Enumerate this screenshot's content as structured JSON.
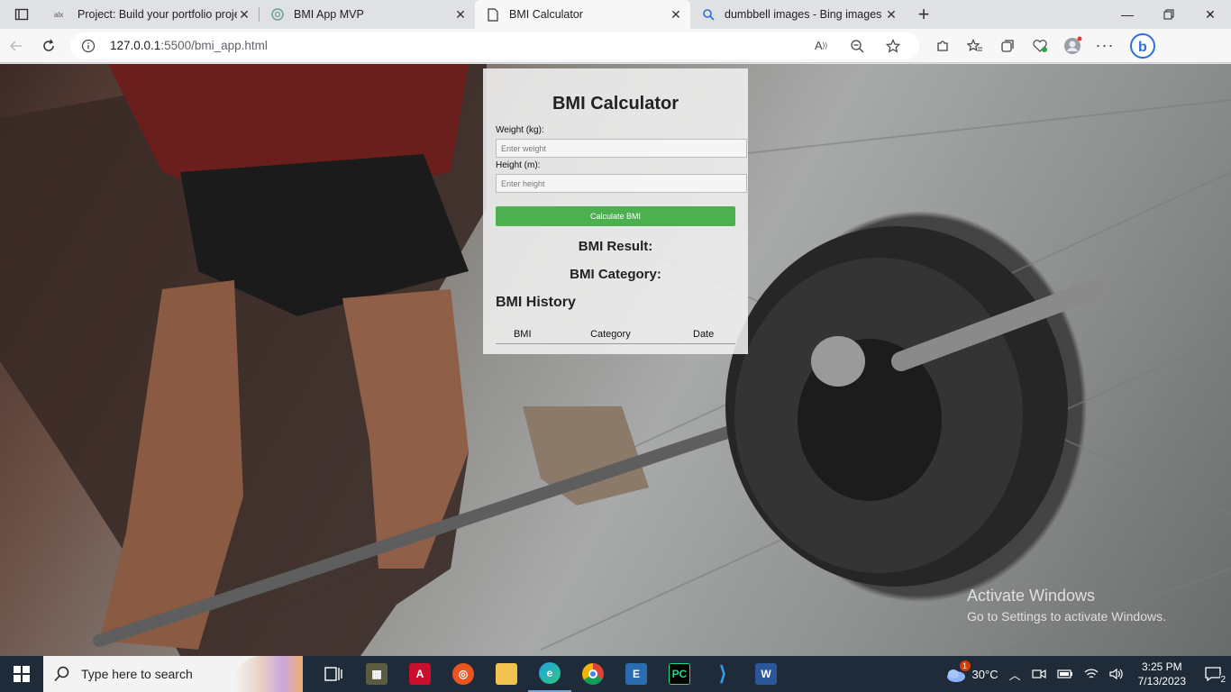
{
  "browser": {
    "tabs": [
      {
        "title": "Project: Build your portfolio proje",
        "icon": "alx-icon",
        "active": false
      },
      {
        "title": "BMI App MVP",
        "icon": "chatgpt-icon",
        "active": false
      },
      {
        "title": "BMI Calculator",
        "icon": "page-icon",
        "active": true
      },
      {
        "title": "dumbbell images - Bing images",
        "icon": "search-icon",
        "active": false
      }
    ],
    "url_host": "127.0.0.1",
    "url_path": ":5500/bmi_app.html"
  },
  "app": {
    "title": "BMI Calculator",
    "weight_label": "Weight (kg):",
    "weight_placeholder": "Enter weight",
    "weight_value": "",
    "height_label": "Height (m):",
    "height_placeholder": "Enter height",
    "height_value": "",
    "calculate_label": "Calculate BMI",
    "result_label": "BMI Result:",
    "category_label": "BMI Category:",
    "history_heading": "BMI History",
    "history_columns": [
      "BMI",
      "Category",
      "Date"
    ],
    "accent_color": "#4caf50"
  },
  "watermark": {
    "line1": "Activate Windows",
    "line2": "Go to Settings to activate Windows."
  },
  "taskbar": {
    "search_placeholder": "Type here to search",
    "weather": "30°C",
    "weather_badge": "1",
    "time": "3:25 PM",
    "date": "7/13/2023",
    "notifications": "2"
  }
}
